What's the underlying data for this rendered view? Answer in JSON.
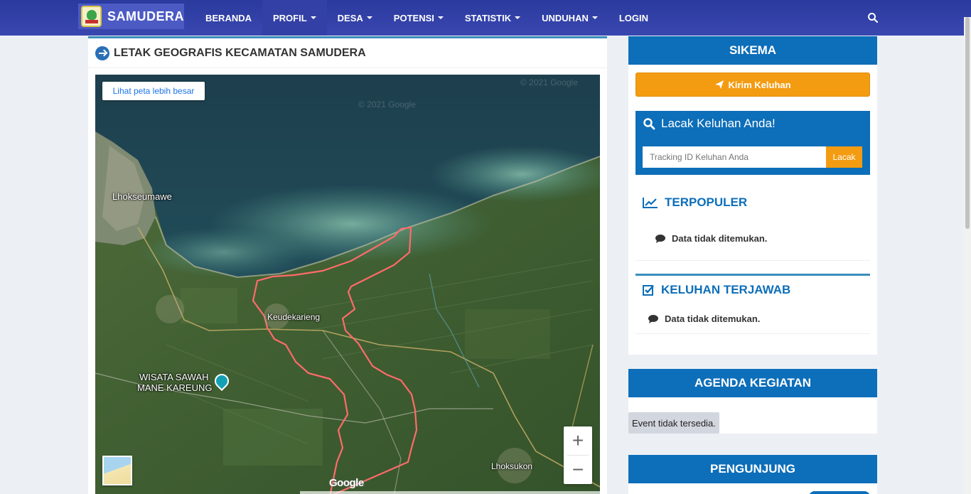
{
  "navbar": {
    "brand": "SAMUDERA",
    "items": [
      {
        "label": "BERANDA",
        "dropdown": false,
        "active": false
      },
      {
        "label": "PROFIL",
        "dropdown": true,
        "active": true
      },
      {
        "label": "DESA",
        "dropdown": true,
        "active": false
      },
      {
        "label": "POTENSI",
        "dropdown": true,
        "active": false
      },
      {
        "label": "STATISTIK",
        "dropdown": true,
        "active": false
      },
      {
        "label": "UNDUHAN",
        "dropdown": true,
        "active": false
      },
      {
        "label": "LOGIN",
        "dropdown": false,
        "active": false
      }
    ],
    "search_icon": "search-icon"
  },
  "main": {
    "title": "LETAK GEOGRAFIS KECAMATAN SAMUDERA",
    "map": {
      "larger_map_link": "Lihat peta lebih besar",
      "labels": {
        "city_lhokseumawe": "Lhokseumawe",
        "town_keudekarieng": "Keudekarieng",
        "poi_line1": "WISATA SAWAH",
        "poi_line2": "MANE KAREUNG",
        "town_lhoksukon": "Lhoksukon"
      },
      "watermark": "© 2021 Google",
      "google_logo": "Google",
      "zoom_in": "+",
      "zoom_out": "−"
    }
  },
  "sidebar": {
    "sikema": {
      "title": "SIKEMA",
      "kirim_label": "Kirim Keluhan",
      "lacak_title": "Lacak Keluhan Anda!",
      "lacak_placeholder": "Tracking ID Keluhan Anda",
      "lacak_button": "Lacak",
      "terpopuler_title": "TERPOPULER",
      "terpopuler_empty": "Data tidak ditemukan.",
      "terjawab_title": "KELUHAN TERJAWAB",
      "terjawab_empty": "Data tidak ditemukan."
    },
    "agenda": {
      "title": "AGENDA KEGIATAN",
      "empty": "Event tidak tersedia."
    },
    "pengunjung": {
      "title": "PENGUNJUNG"
    }
  },
  "colors": {
    "navbar": "#3947b0",
    "primary": "#0d6eb9",
    "accent": "#f39c12",
    "panel_border": "#3c8dbc"
  }
}
